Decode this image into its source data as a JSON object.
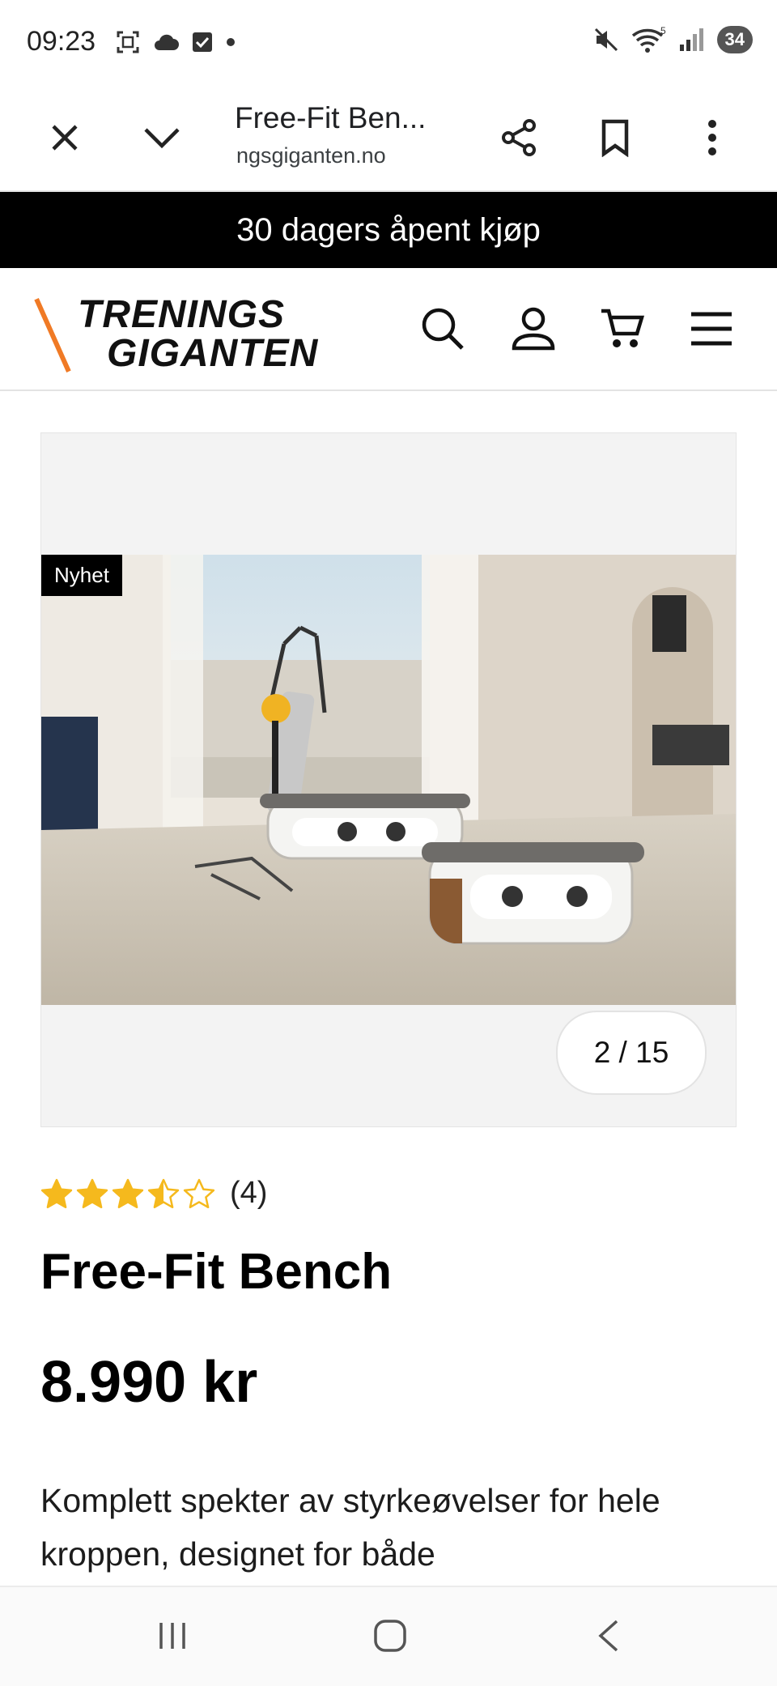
{
  "status_bar": {
    "time": "09:23",
    "left_icons": [
      "screenshot-icon",
      "cloud-icon",
      "checkbox-icon",
      "dot-icon"
    ],
    "right_icons": [
      "mute-icon",
      "wifi-icon",
      "signal-icon"
    ],
    "wifi_label": "5",
    "battery": "34"
  },
  "browser": {
    "title": "Free-Fit Ben...",
    "url": "ngsgiganten.no",
    "icons": [
      "close-icon",
      "chevron-down-icon",
      "share-icon",
      "bookmark-icon",
      "more-vertical-icon"
    ]
  },
  "promo": {
    "text": "30 dagers åpent kjøp"
  },
  "header": {
    "logo_line1": "TRENINGS",
    "logo_line2": "GIGANTEN",
    "logo_accent": "#f07a25",
    "icons": [
      "search-icon",
      "account-icon",
      "cart-icon",
      "menu-icon"
    ]
  },
  "gallery": {
    "badge": "Nyhet",
    "counter": "2 / 15",
    "current": 2,
    "total": 15
  },
  "product": {
    "rating": 3.5,
    "rating_max": 5,
    "rating_count": "(4)",
    "star_color": "#f5b91d",
    "title": "Free-Fit Bench",
    "price": "8.990 kr",
    "description": "Komplett spekter av styrkeøvelser for hele kroppen, designet for både"
  },
  "navbar": {
    "icons": [
      "recent-apps-icon",
      "home-icon",
      "back-icon"
    ]
  }
}
